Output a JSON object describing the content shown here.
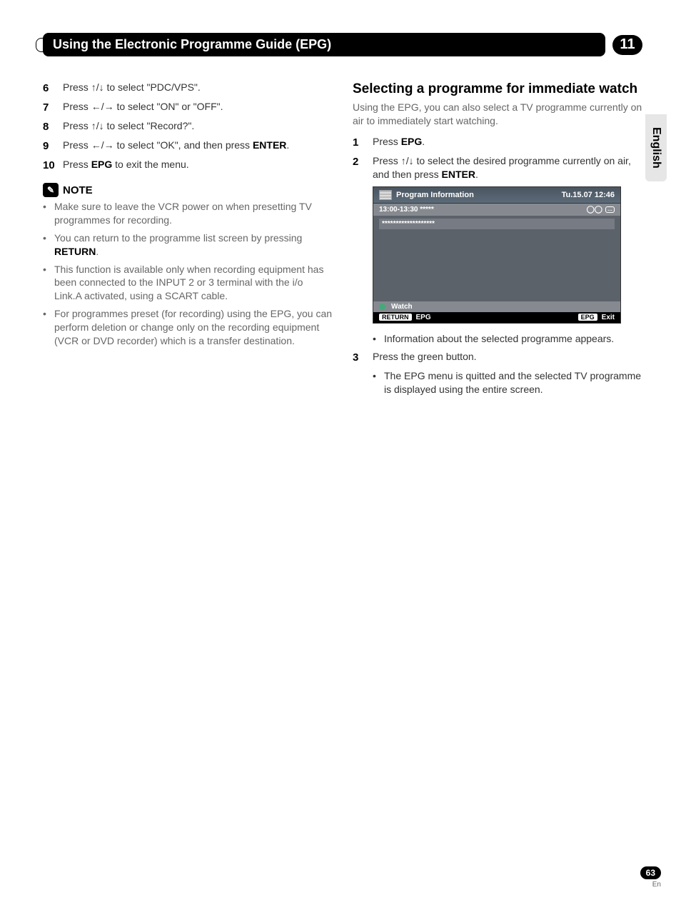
{
  "header": {
    "title": "Using the Electronic Programme Guide (EPG)",
    "chapter": "11"
  },
  "sideTab": "English",
  "leftColumn": {
    "steps": [
      {
        "num": "6",
        "pre": "Press ",
        "arrows": "↑/↓",
        "post": " to select \"PDC/VPS\"."
      },
      {
        "num": "7",
        "pre": "Press ",
        "arrows": "←/→",
        "post": " to select \"ON\" or \"OFF\"."
      },
      {
        "num": "8",
        "pre": "Press ",
        "arrows": "↑/↓",
        "post": " to select \"Record?\"."
      },
      {
        "num": "9",
        "pre": "Press ",
        "arrows": "←/→",
        "post": " to select \"OK\", and then press ",
        "bold2": "ENTER",
        "post2": "."
      },
      {
        "num": "10",
        "pre": "Press ",
        "bold1": "EPG",
        "post": " to exit the menu."
      }
    ],
    "noteLabel": "NOTE",
    "notes": [
      "Make sure to leave the VCR power on when presetting TV programmes for recording.",
      "You can return to the programme list screen by pressing RETURN.",
      "This function is available only when recording equipment has been connected to the INPUT 2 or 3 terminal with the i/o Link.A activated, using a SCART cable.",
      "For programmes preset (for recording) using the EPG, you can perform deletion or change only on the recording equipment (VCR or DVD recorder) which is a transfer destination."
    ]
  },
  "rightColumn": {
    "sectionTitle": "Selecting a programme for immediate watch",
    "sectionIntro": "Using the EPG, you can also select a TV programme currently on air to immediately start watching.",
    "steps": [
      {
        "num": "1",
        "pre": "Press ",
        "bold1": "EPG",
        "post": "."
      },
      {
        "num": "2",
        "pre": "Press ",
        "arrows": "↑/↓",
        "post": " to select the desired programme currently on air, and then press ",
        "bold2": "ENTER",
        "post2": "."
      }
    ],
    "osd": {
      "title": "Program Information",
      "datetime": "Tu.15.07 12:46",
      "timeslot": "13:00-13:30 *****",
      "bodyRow": "*******************",
      "watch": "Watch",
      "returnKey": "RETURN",
      "returnLabel": "EPG",
      "epgKey": "EPG",
      "exitLabel": "Exit"
    },
    "afterOsd": "Information about the selected programme appears.",
    "step3": {
      "num": "3",
      "text": "Press the green button."
    },
    "step3sub": "The EPG menu is quitted and the selected TV programme is displayed using the entire screen."
  },
  "footer": {
    "pageNum": "63",
    "lang": "En"
  }
}
